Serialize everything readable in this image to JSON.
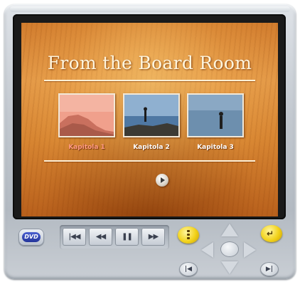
{
  "screen": {
    "title": "From the Board Room",
    "chapters": [
      {
        "label": "Kapitola 1",
        "selected": true
      },
      {
        "label": "Kapitola 2",
        "selected": false
      },
      {
        "label": "Kapitola 3",
        "selected": false
      }
    ],
    "play_icon": "play-icon"
  },
  "controls": {
    "dvd_logo": "DVD",
    "transport": {
      "previous": "|◀◀",
      "rewind": "◀◀",
      "pause": "❚❚",
      "fast_forward": "▶▶"
    },
    "menu_icon": "menu-icon",
    "enter_icon": "enter-icon",
    "skip_back": "|◀",
    "skip_forward": "▶|"
  },
  "colors": {
    "screen_wood": "#d88632",
    "selected_chapter_text": "#ff9a84",
    "highlight_yellow": "#f2d21a",
    "player_silver": "#c3c9d0"
  }
}
